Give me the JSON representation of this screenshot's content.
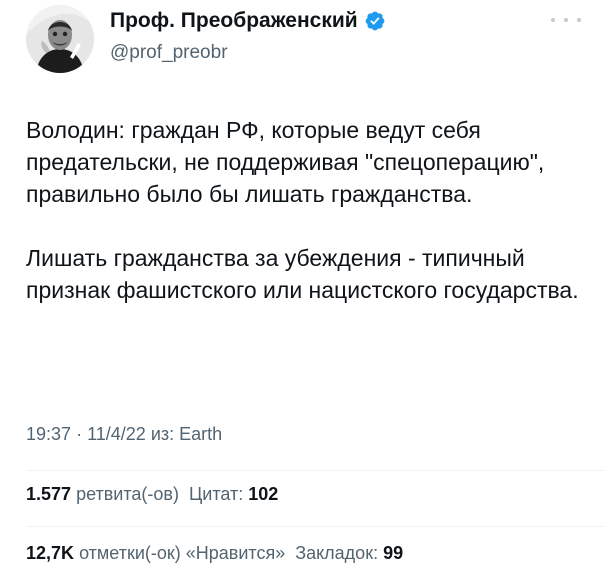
{
  "author": {
    "display_name": "Проф. Преображенский",
    "handle": "@prof_preobr",
    "verified": true,
    "avatar_icon": "author-portrait-avatar"
  },
  "tweet": {
    "paragraphs": [
      "Володин: граждан РФ, которые ведут себя предательски, не поддерживая \"спецоперацию\", правильно было бы лишать гражданства.",
      "Лишать гражданства за убеждения - типичный признак фашистского или нацистского государства."
    ],
    "time": "19:37",
    "separator": "·",
    "date": "11/4/22",
    "source_prefix": "из:",
    "source": "Earth"
  },
  "stats": {
    "retweets_count": "1.577",
    "retweets_label": "ретвита(-ов)",
    "quotes_label": "Цитат:",
    "quotes_count": "102",
    "likes_count": "12,7K",
    "likes_label": "отметки(-ок) «Нравится»",
    "bookmarks_label": "Закладок:",
    "bookmarks_count": "99"
  },
  "colors": {
    "text": "#0f1419",
    "secondary": "#536471",
    "verified_badge": "#1d9bf0",
    "divider": "#eff3f4"
  }
}
